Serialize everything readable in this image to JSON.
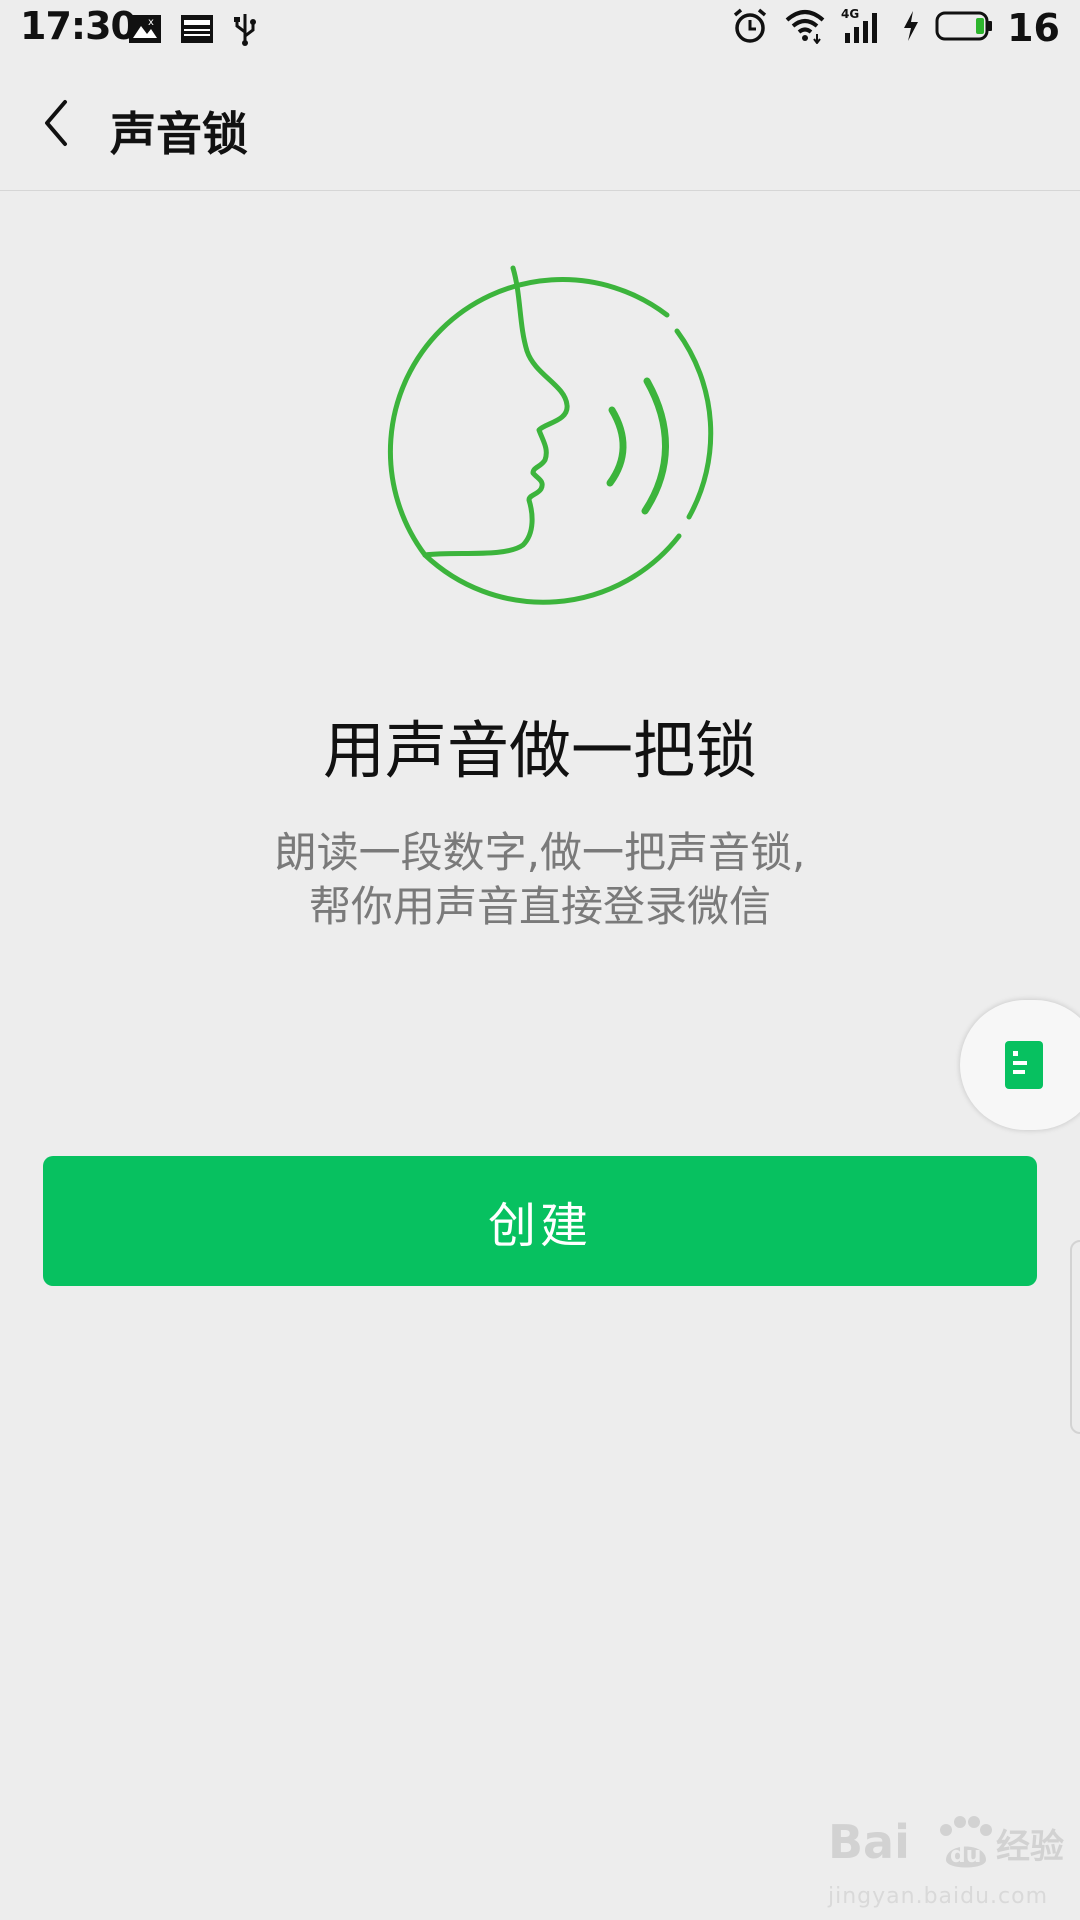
{
  "status_bar": {
    "time": "17:30",
    "battery_level": "16",
    "network": "4G",
    "left_icons": [
      "image-icon",
      "news-icon",
      "usb-icon"
    ],
    "right_icons": [
      "alarm-icon",
      "wifi-icon",
      "signal-icon",
      "charging-icon",
      "battery-icon"
    ]
  },
  "app_bar": {
    "title": "声音锁"
  },
  "main": {
    "headline": "用声音做一把锁",
    "description_lines": [
      "朗读一段数字,做一把声音锁,",
      "帮你用声音直接登录微信"
    ],
    "create_label": "创建"
  },
  "watermark": {
    "text": "Bai du 经验",
    "sub": "jingyan.baidu.com"
  },
  "colors": {
    "accent": "#07c160",
    "illustration": "#3cb43c",
    "background": "#ededed"
  }
}
